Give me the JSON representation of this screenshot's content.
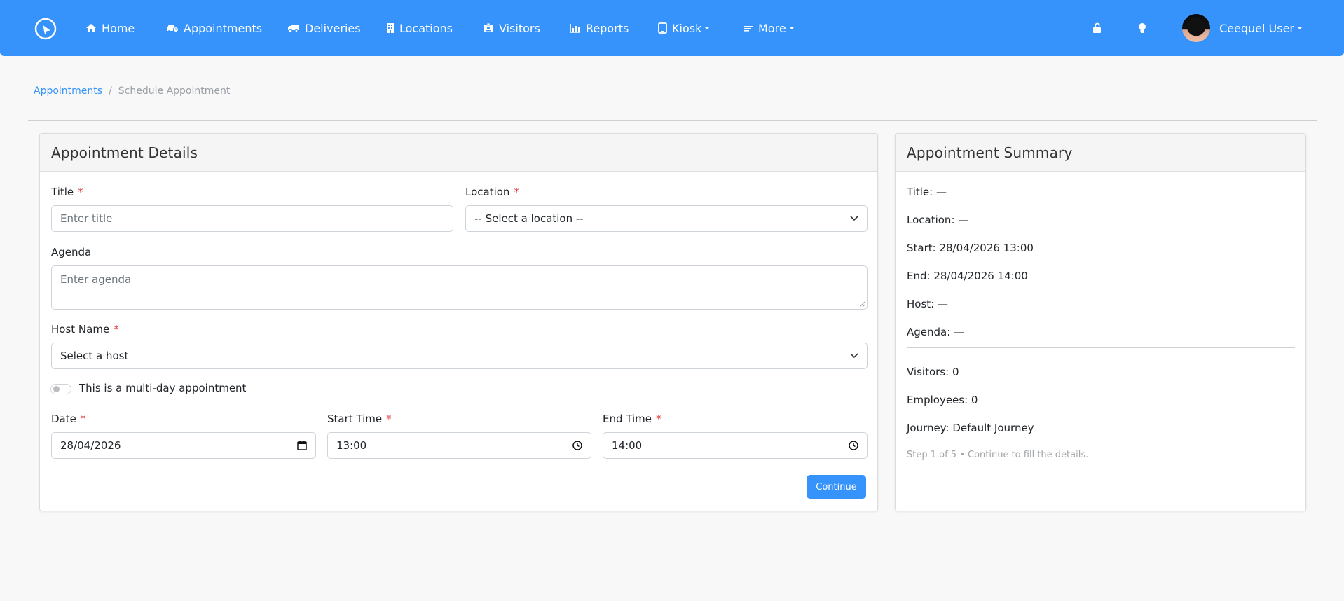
{
  "colors": {
    "primary": "#3593fb",
    "required": "#e23c3c"
  },
  "nav": {
    "logo_icon": "cursor-circle-icon",
    "items": [
      {
        "label": "Home",
        "icon": "home-icon"
      },
      {
        "label": "Appointments",
        "icon": "car-clock-icon"
      },
      {
        "label": "Deliveries",
        "icon": "truck-icon"
      },
      {
        "label": "Locations",
        "icon": "building-icon"
      },
      {
        "label": "Visitors",
        "icon": "id-badge-icon"
      },
      {
        "label": "Reports",
        "icon": "bar-chart-icon"
      },
      {
        "label": "Kiosk",
        "icon": "tablet-icon"
      },
      {
        "label": "More",
        "icon": "lines-icon"
      }
    ],
    "user_name": "Ceequel User"
  },
  "breadcrumb": {
    "parent": "Appointments",
    "separator": "/",
    "current": "Schedule Appointment"
  },
  "form": {
    "header": "Appointment Details",
    "title_label": "Title",
    "title_placeholder": "Enter title",
    "location_label": "Location",
    "location_value": "-- Select a location --",
    "agenda_label": "Agenda",
    "agenda_placeholder": "Enter agenda",
    "host_label": "Host Name",
    "host_value": "Select a host",
    "multiday_label": "This is a multi-day appointment",
    "multiday_enabled": false,
    "date_label": "Date",
    "date_value": "28/04/2026",
    "start_label": "Start Time",
    "start_value": "13:00",
    "end_label": "End Time",
    "end_value": "14:00",
    "required_mark": "*",
    "continue_label": "Continue"
  },
  "summary": {
    "header": "Appointment Summary",
    "title": "Title: —",
    "location": "Location: —",
    "start": "Start: 28/04/2026 13:00",
    "end": "End: 28/04/2026 14:00",
    "host": "Host: —",
    "agenda": "Agenda: —",
    "visitors": "Visitors: 0",
    "employees": "Employees: 0",
    "journey": "Journey: Default Journey",
    "note": "Step 1 of 5 • Continue to fill the details."
  }
}
